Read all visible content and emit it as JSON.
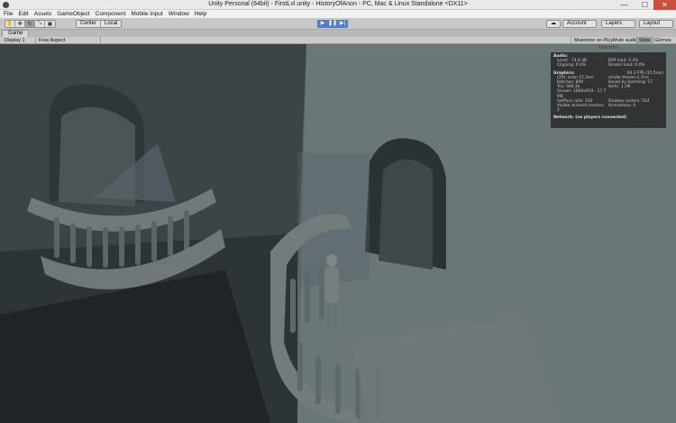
{
  "window": {
    "title": "Unity Personal (64bit) - FirstLvl.unity - HistoryOfAnon - PC, Mac & Linux Standalone <DX11>",
    "min_glyph": "—",
    "max_glyph": "☐",
    "close_glyph": "✕"
  },
  "menu": [
    "File",
    "Edit",
    "Assets",
    "GameObject",
    "Component",
    "Mobile Input",
    "Window",
    "Help"
  ],
  "toolbar": {
    "tools": [
      "hand-icon",
      "move-icon",
      "rotate-icon",
      "scale-icon",
      "rect-icon"
    ],
    "tool_glyphs": [
      "✋",
      "✥",
      "↻",
      "⤡",
      "▣"
    ],
    "pivot": "Center",
    "space": "Local",
    "play_glyph": "▶",
    "pause_glyph": "❚❚",
    "step_glyph": "▶|",
    "cloud_glyph": "☁",
    "account": "Account",
    "layers": "Layers",
    "layout": "Layout",
    "accent": "#4c7cd2"
  },
  "game_view": {
    "tab": "Game",
    "display": "Display 1",
    "aspect": "Free Aspect",
    "maximize": "Maximize on Play",
    "mute": "Mute audio",
    "stats": "Stats",
    "gizmos": "Gizmos"
  },
  "statistics": {
    "header": "Statistics",
    "audio_title": "Audio:",
    "level_label": "Level: -74.8 dB",
    "dsp_load": "DSP load: 0.3%",
    "clipping": "Clipping: 0.0%",
    "stream_load": "Stream load: 0.0%",
    "graphics_title": "Graphics:",
    "fps": "64.3 FPS (15.5ms)",
    "cpu": "CPU: main 15.3ms",
    "render_thread": "render thread 4.7ms",
    "batches": "Batches: 849",
    "saved_batching": "Saved by batching: 17",
    "tris": "Tris: 949.3k",
    "verts": "Verts: 1.1M",
    "screen": "Screen: 1680x919 - 17.7 MB",
    "setpass": "SetPass calls: 192",
    "shadow_casters": "Shadow casters: 524",
    "skinned": "Visible skinned meshes: 2",
    "animations": "Animations: 0",
    "network": "Network: (no players connected)"
  }
}
